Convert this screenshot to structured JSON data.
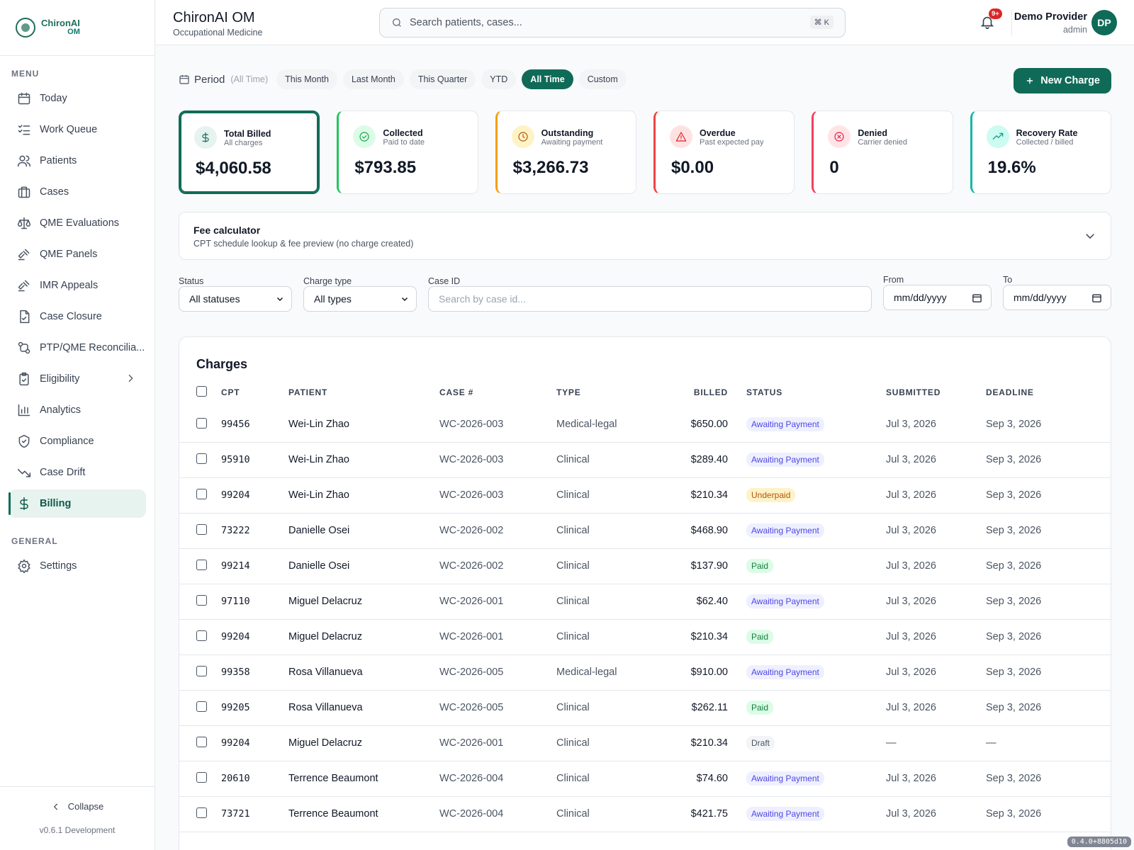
{
  "brand": {
    "logo_line1": "ChironAI",
    "logo_line2": "OM"
  },
  "header": {
    "title": "ChironAI OM",
    "subtitle": "Occupational Medicine",
    "search_placeholder": "Search patients, cases...",
    "shortcut": "⌘ K",
    "notifications_badge": "9+",
    "user_name": "Demo Provider",
    "user_role": "admin",
    "avatar_initials": "DP"
  },
  "sidebar": {
    "menu_heading": "MENU",
    "items": [
      {
        "label": "Today",
        "icon": "calendar-icon"
      },
      {
        "label": "Work Queue",
        "icon": "list-checks-icon"
      },
      {
        "label": "Patients",
        "icon": "users-icon"
      },
      {
        "label": "Cases",
        "icon": "briefcase-icon"
      },
      {
        "label": "QME Evaluations",
        "icon": "scale-icon"
      },
      {
        "label": "QME Panels",
        "icon": "gavel-icon"
      },
      {
        "label": "IMR Appeals",
        "icon": "gavel-icon"
      },
      {
        "label": "Case Closure",
        "icon": "file-check-icon"
      },
      {
        "label": "PTP/QME Reconcilia...",
        "icon": "git-compare-icon"
      },
      {
        "label": "Eligibility",
        "icon": "clipboard-check-icon"
      },
      {
        "label": "Analytics",
        "icon": "bar-chart-icon"
      },
      {
        "label": "Compliance",
        "icon": "shield-check-icon"
      },
      {
        "label": "Case Drift",
        "icon": "trending-down-icon"
      },
      {
        "label": "Billing",
        "icon": "dollar-icon"
      }
    ],
    "general_heading": "GENERAL",
    "settings_label": "Settings",
    "collapse_label": "Collapse",
    "version": "v0.6.1 Development"
  },
  "period": {
    "label": "Period",
    "hint": "(All Time)",
    "options": [
      "This Month",
      "Last Month",
      "This Quarter",
      "YTD",
      "All Time",
      "Custom"
    ],
    "selected": "All Time"
  },
  "new_charge_label": "New Charge",
  "kpis": [
    {
      "title": "Total Billed",
      "sub": "All charges",
      "value": "$4,060.58",
      "color": "#0f6b57"
    },
    {
      "title": "Collected",
      "sub": "Paid to date",
      "value": "$793.85",
      "color": "#22c55e"
    },
    {
      "title": "Outstanding",
      "sub": "Awaiting payment",
      "value": "$3,266.73",
      "color": "#f59e0b"
    },
    {
      "title": "Overdue",
      "sub": "Past expected pay",
      "value": "$0.00",
      "color": "#ef4444"
    },
    {
      "title": "Denied",
      "sub": "Carrier denied",
      "value": "0",
      "color": "#f43f5e"
    },
    {
      "title": "Recovery Rate",
      "sub": "Collected / billed",
      "value": "19.6%",
      "color": "#14b8a6"
    }
  ],
  "fee_calculator": {
    "title": "Fee calculator",
    "subtitle": "CPT schedule lookup & fee preview (no charge created)"
  },
  "filters": {
    "status_label": "Status",
    "status_value": "All statuses",
    "type_label": "Charge type",
    "type_value": "All types",
    "case_label": "Case ID",
    "case_placeholder": "Search by case id...",
    "from_label": "From",
    "from_placeholder": "mm/dd/yyyy",
    "to_label": "To",
    "to_placeholder": "mm/dd/yyyy"
  },
  "charges": {
    "title": "Charges",
    "columns": [
      "CPT",
      "PATIENT",
      "CASE #",
      "TYPE",
      "BILLED",
      "STATUS",
      "SUBMITTED",
      "DEADLINE"
    ],
    "rows": [
      {
        "cpt": "99456",
        "patient": "Wei-Lin Zhao",
        "case": "WC-2026-003",
        "type": "Medical-legal",
        "billed": "$650.00",
        "status": "Awaiting Payment",
        "submitted": "Jul 3, 2026",
        "deadline": "Sep 3, 2026"
      },
      {
        "cpt": "95910",
        "patient": "Wei-Lin Zhao",
        "case": "WC-2026-003",
        "type": "Clinical",
        "billed": "$289.40",
        "status": "Awaiting Payment",
        "submitted": "Jul 3, 2026",
        "deadline": "Sep 3, 2026"
      },
      {
        "cpt": "99204",
        "patient": "Wei-Lin Zhao",
        "case": "WC-2026-003",
        "type": "Clinical",
        "billed": "$210.34",
        "status": "Underpaid",
        "submitted": "Jul 3, 2026",
        "deadline": "Sep 3, 2026"
      },
      {
        "cpt": "73222",
        "patient": "Danielle Osei",
        "case": "WC-2026-002",
        "type": "Clinical",
        "billed": "$468.90",
        "status": "Awaiting Payment",
        "submitted": "Jul 3, 2026",
        "deadline": "Sep 3, 2026"
      },
      {
        "cpt": "99214",
        "patient": "Danielle Osei",
        "case": "WC-2026-002",
        "type": "Clinical",
        "billed": "$137.90",
        "status": "Paid",
        "submitted": "Jul 3, 2026",
        "deadline": "Sep 3, 2026"
      },
      {
        "cpt": "97110",
        "patient": "Miguel Delacruz",
        "case": "WC-2026-001",
        "type": "Clinical",
        "billed": "$62.40",
        "status": "Awaiting Payment",
        "submitted": "Jul 3, 2026",
        "deadline": "Sep 3, 2026"
      },
      {
        "cpt": "99204",
        "patient": "Miguel Delacruz",
        "case": "WC-2026-001",
        "type": "Clinical",
        "billed": "$210.34",
        "status": "Paid",
        "submitted": "Jul 3, 2026",
        "deadline": "Sep 3, 2026"
      },
      {
        "cpt": "99358",
        "patient": "Rosa Villanueva",
        "case": "WC-2026-005",
        "type": "Medical-legal",
        "billed": "$910.00",
        "status": "Awaiting Payment",
        "submitted": "Jul 3, 2026",
        "deadline": "Sep 3, 2026"
      },
      {
        "cpt": "99205",
        "patient": "Rosa Villanueva",
        "case": "WC-2026-005",
        "type": "Clinical",
        "billed": "$262.11",
        "status": "Paid",
        "submitted": "Jul 3, 2026",
        "deadline": "Sep 3, 2026"
      },
      {
        "cpt": "99204",
        "patient": "Miguel Delacruz",
        "case": "WC-2026-001",
        "type": "Clinical",
        "billed": "$210.34",
        "status": "Draft",
        "submitted": "—",
        "deadline": "—"
      },
      {
        "cpt": "20610",
        "patient": "Terrence Beaumont",
        "case": "WC-2026-004",
        "type": "Clinical",
        "billed": "$74.60",
        "status": "Awaiting Payment",
        "submitted": "Jul 3, 2026",
        "deadline": "Sep 3, 2026"
      },
      {
        "cpt": "73721",
        "patient": "Terrence Beaumont",
        "case": "WC-2026-004",
        "type": "Clinical",
        "billed": "$421.75",
        "status": "Awaiting Payment",
        "submitted": "Jul 3, 2026",
        "deadline": "Sep 3, 2026"
      }
    ]
  },
  "build_tag": "0.4.0+8805d10"
}
